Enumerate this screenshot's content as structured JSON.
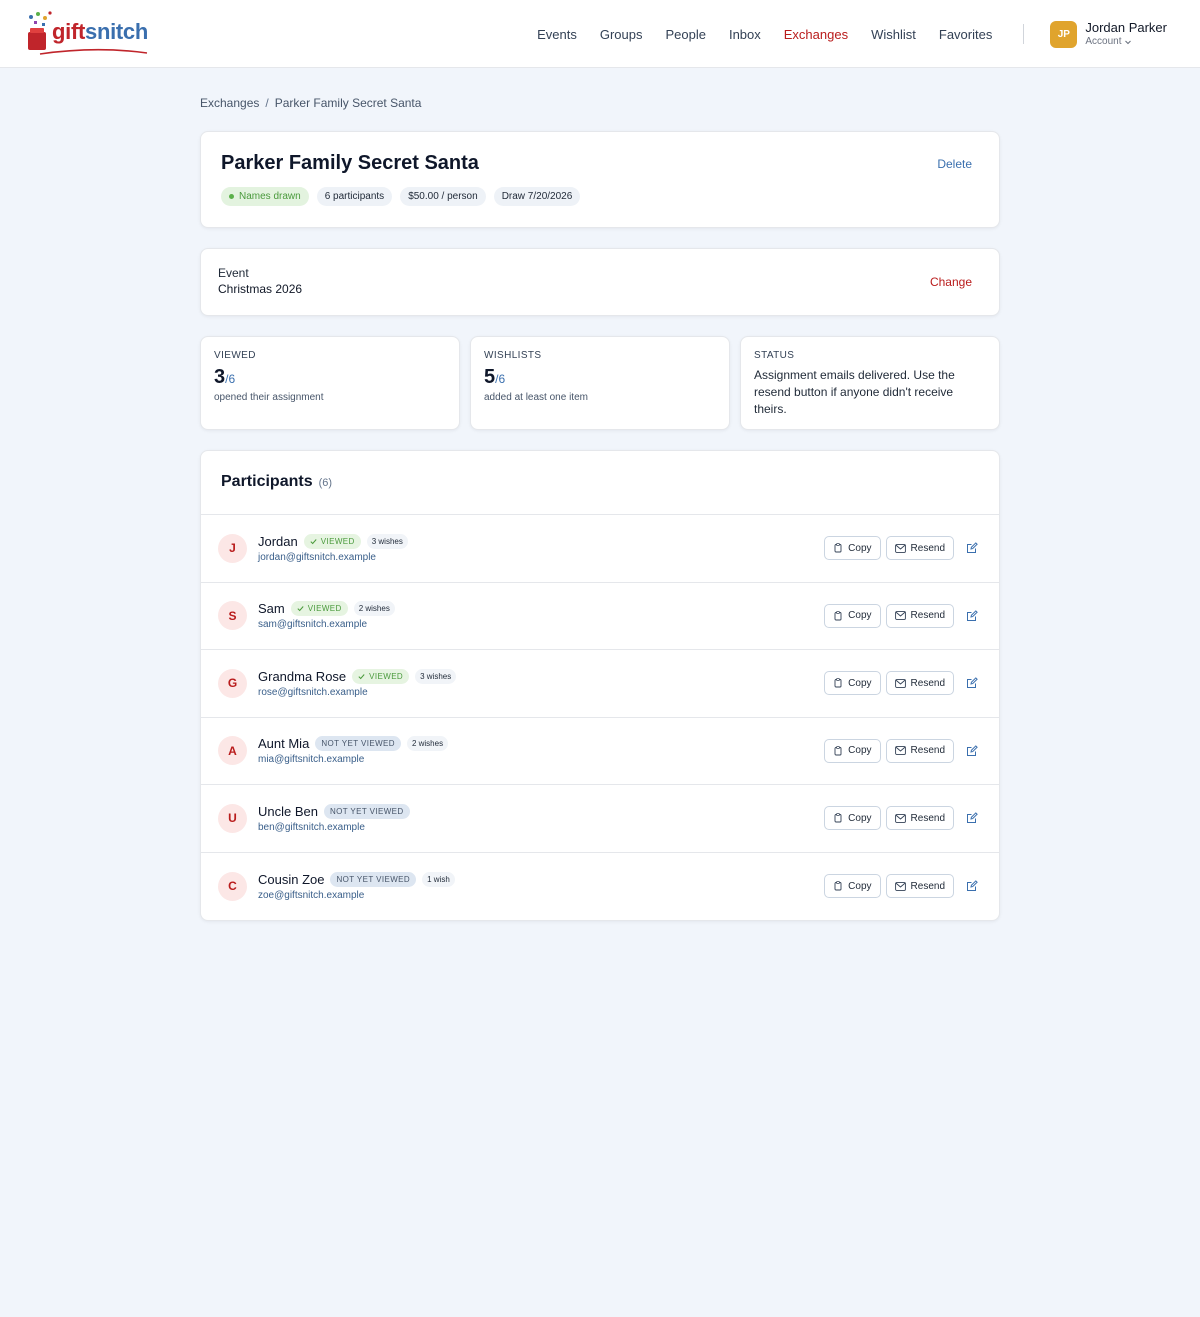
{
  "brand": {
    "name_part1": "gift",
    "name_part2": "snitch",
    "colors": {
      "red": "#c0252b",
      "blue": "#3a6fae"
    }
  },
  "nav": {
    "items": [
      {
        "label": "Events",
        "active": false
      },
      {
        "label": "Groups",
        "active": false
      },
      {
        "label": "People",
        "active": false
      },
      {
        "label": "Inbox",
        "active": false
      },
      {
        "label": "Exchanges",
        "active": true
      },
      {
        "label": "Wishlist",
        "active": false
      },
      {
        "label": "Favorites",
        "active": false
      }
    ],
    "account": {
      "initials": "JP",
      "name": "Jordan Parker",
      "sub_label": "Account",
      "icon": "chevron-down-icon"
    }
  },
  "breadcrumb": {
    "parent": "Exchanges",
    "separator": "/",
    "current": "Parker Family Secret Santa"
  },
  "header": {
    "title": "Parker Family Secret Santa",
    "delete_label": "Delete",
    "chips": {
      "status": "Names drawn",
      "participants": "6 participants",
      "budget": "$50.00 / person",
      "draw": "Draw 7/20/2026"
    }
  },
  "event": {
    "label": "Event",
    "value": "Christmas 2026",
    "change_label": "Change"
  },
  "stats": {
    "viewed": {
      "label": "VIEWED",
      "value": "3",
      "denominator": "/6",
      "sub": "opened their assignment"
    },
    "wishlists": {
      "label": "WISHLISTS",
      "value": "5",
      "denominator": "/6",
      "sub": "added at least one item"
    },
    "status": {
      "label": "STATUS",
      "text": "Assignment emails delivered. Use the resend button if anyone didn't receive theirs."
    }
  },
  "participants": {
    "title": "Participants",
    "count": "(6)",
    "copy_label": "Copy",
    "resend_label": "Resend",
    "rows": [
      {
        "initial": "J",
        "name": "Jordan",
        "status": "VIEWED",
        "viewed": true,
        "wishes": "3 wishes",
        "email": "jordan@giftsnitch.example"
      },
      {
        "initial": "S",
        "name": "Sam",
        "status": "VIEWED",
        "viewed": true,
        "wishes": "2 wishes",
        "email": "sam@giftsnitch.example"
      },
      {
        "initial": "G",
        "name": "Grandma Rose",
        "status": "VIEWED",
        "viewed": true,
        "wishes": "3 wishes",
        "email": "rose@giftsnitch.example"
      },
      {
        "initial": "A",
        "name": "Aunt Mia",
        "status": "NOT YET VIEWED",
        "viewed": false,
        "wishes": "2 wishes",
        "email": "mia@giftsnitch.example"
      },
      {
        "initial": "U",
        "name": "Uncle Ben",
        "status": "NOT YET VIEWED",
        "viewed": false,
        "wishes": "",
        "email": "ben@giftsnitch.example"
      },
      {
        "initial": "C",
        "name": "Cousin Zoe",
        "status": "NOT YET VIEWED",
        "viewed": false,
        "wishes": "1 wish",
        "email": "zoe@giftsnitch.example"
      }
    ]
  }
}
